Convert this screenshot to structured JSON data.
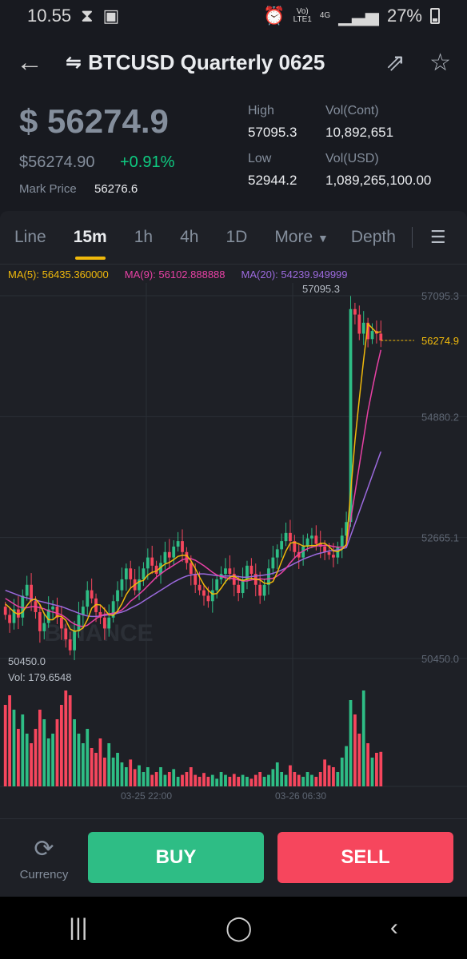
{
  "status_bar": {
    "time": "10.55",
    "network_top": "Vo)",
    "network_bottom": "LTE1",
    "data_type": "4G",
    "battery": "27%"
  },
  "header": {
    "title": "BTCUSD Quarterly 0625",
    "swap_icon": "swap-arrows-icon",
    "share_icon": "share-icon",
    "favorite_icon": "star-icon"
  },
  "price": {
    "main": "$ 56274.9",
    "secondary": "$56274.90",
    "change": "+0.91%",
    "mark_label": "Mark Price",
    "mark_value": "56276.6",
    "high_label": "High",
    "high_value": "57095.3",
    "low_label": "Low",
    "low_value": "52944.2",
    "vol_cont_label": "Vol(Cont)",
    "vol_cont_value": "10,892,651",
    "vol_usd_label": "Vol(USD)",
    "vol_usd_value": "1,089,265,100.00"
  },
  "tabs": [
    {
      "label": "Line"
    },
    {
      "label": "15m"
    },
    {
      "label": "1h"
    },
    {
      "label": "4h"
    },
    {
      "label": "1D"
    },
    {
      "label": "More"
    },
    {
      "label": "Depth"
    }
  ],
  "ma": {
    "ma5": "MA(5): 56435.360000",
    "ma9": "MA(9): 56102.888888",
    "ma20": "MA(20): 54239.949999"
  },
  "colors": {
    "up": "#2ebd85",
    "down": "#f6465d",
    "ma5": "#f0b90b",
    "ma9": "#e841a5",
    "ma20": "#9c6ade"
  },
  "chart_data": {
    "type": "candlestick",
    "y_ticks": [
      57095.3,
      54880.2,
      52665.1,
      50450.0
    ],
    "y_tick_labels": [
      "57095.3",
      "54880.2",
      "52665.1",
      "50450.0"
    ],
    "ylim": [
      50450.0,
      57095.3
    ],
    "x_tick_labels": [
      "03-25 22:00",
      "03-26 06:30"
    ],
    "high_label": "57095.3",
    "low_label": "50450.0",
    "last_price_label": "56274.9",
    "volume_label": "Vol: 179.6548",
    "watermark": "BINANCE",
    "close_series": [
      51250,
      51100,
      51350,
      51200,
      51600,
      51800,
      51500,
      51300,
      50950,
      51100,
      51350,
      51400,
      51200,
      51000,
      50800,
      50600,
      50950,
      51250,
      51400,
      51700,
      51550,
      51300,
      51200,
      51000,
      51200,
      51500,
      51700,
      51900,
      52100,
      51900,
      51700,
      51900,
      52100,
      52300,
      52150,
      52000,
      52200,
      52400,
      52300,
      52500,
      52600,
      52400,
      52200,
      52000,
      51800,
      51700,
      51600,
      51500,
      51700,
      51900,
      52000,
      52100,
      52000,
      51800,
      51650,
      51900,
      52150,
      52000,
      51800,
      51600,
      51800,
      52100,
      52300,
      52450,
      52600,
      52750,
      52600,
      52400,
      52300,
      52500,
      52650,
      52700,
      52550,
      52500,
      52400,
      52350,
      52300,
      52500,
      52700,
      52950,
      56850,
      56750,
      56400,
      56600,
      56300,
      56450,
      56400,
      56274.9
    ],
    "ma5_series": [
      51450,
      51380,
      51300,
      51260,
      51300,
      51420,
      51520,
      51540,
      51440,
      51270,
      51160,
      51160,
      51230,
      51220,
      51150,
      50990,
      50950,
      50960,
      51010,
      51160,
      51370,
      51440,
      51430,
      51350,
      51250,
      51240,
      51320,
      51450,
      51620,
      51740,
      51800,
      51860,
      51880,
      51980,
      52030,
      52050,
      52120,
      52180,
      52210,
      52260,
      52320,
      52340,
      52340,
      52240,
      52100,
      51940,
      51800,
      51700,
      51630,
      51640,
      51740,
      51860,
      51940,
      51960,
      51910,
      51880,
      51900,
      51920,
      51900,
      51890,
      51830,
      51820,
      51860,
      52030,
      52230,
      52420,
      52560,
      52580,
      52550,
      52510,
      52510,
      52520,
      52520,
      52560,
      52560,
      52500,
      52420,
      52410,
      52450,
      52540,
      53490,
      54440,
      55200,
      55920,
      56580,
      56500,
      56420,
      56435.36
    ],
    "ma9_series": [
      51550,
      51500,
      51450,
      51400,
      51380,
      51380,
      51400,
      51400,
      51380,
      51360,
      51320,
      51300,
      51280,
      51250,
      51200,
      51130,
      51080,
      51050,
      51030,
      51060,
      51120,
      51180,
      51230,
      51260,
      51270,
      51280,
      51300,
      51340,
      51410,
      51500,
      51560,
      51630,
      51700,
      51780,
      51860,
      51940,
      52000,
      52060,
      52110,
      52160,
      52210,
      52260,
      52280,
      52280,
      52250,
      52200,
      52150,
      52090,
      52030,
      51980,
      51950,
      51930,
      51920,
      51910,
      51890,
      51870,
      51870,
      51890,
      51900,
      51910,
      51900,
      51910,
      51920,
      51960,
      52020,
      52100,
      52200,
      52290,
      52370,
      52420,
      52460,
      52490,
      52510,
      52520,
      52520,
      52520,
      52500,
      52490,
      52490,
      52510,
      52990,
      53480,
      53980,
      54480,
      54980,
      55380,
      55760,
      56102.89
    ],
    "ma20_series": [
      51700,
      51670,
      51640,
      51610,
      51580,
      51560,
      51540,
      51520,
      51500,
      51480,
      51460,
      51440,
      51420,
      51400,
      51370,
      51340,
      51310,
      51280,
      51250,
      51230,
      51220,
      51220,
      51230,
      51240,
      51250,
      51260,
      51280,
      51300,
      51330,
      51370,
      51410,
      51450,
      51500,
      51550,
      51600,
      51650,
      51700,
      51750,
      51800,
      51850,
      51890,
      51930,
      51960,
      51980,
      51990,
      52000,
      52000,
      51990,
      51980,
      51970,
      51960,
      51960,
      51960,
      51960,
      51950,
      51940,
      51940,
      51950,
      51960,
      51970,
      51980,
      51990,
      52010,
      52040,
      52070,
      52110,
      52150,
      52190,
      52230,
      52270,
      52300,
      52330,
      52360,
      52380,
      52400,
      52420,
      52430,
      52440,
      52460,
      52480,
      52700,
      52920,
      53140,
      53360,
      53580,
      53800,
      54020,
      54239.95
    ],
    "volume_series": [
      0.85,
      0.95,
      0.8,
      0.6,
      0.75,
      0.55,
      0.45,
      0.6,
      0.8,
      0.7,
      0.5,
      0.55,
      0.7,
      0.85,
      1.0,
      0.95,
      0.7,
      0.55,
      0.45,
      0.6,
      0.4,
      0.35,
      0.5,
      0.3,
      0.45,
      0.3,
      0.35,
      0.25,
      0.2,
      0.28,
      0.18,
      0.22,
      0.15,
      0.2,
      0.12,
      0.15,
      0.2,
      0.12,
      0.15,
      0.18,
      0.1,
      0.12,
      0.15,
      0.2,
      0.12,
      0.1,
      0.14,
      0.1,
      0.12,
      0.08,
      0.15,
      0.12,
      0.1,
      0.13,
      0.1,
      0.12,
      0.1,
      0.08,
      0.12,
      0.15,
      0.1,
      0.12,
      0.18,
      0.25,
      0.15,
      0.12,
      0.22,
      0.15,
      0.12,
      0.1,
      0.15,
      0.12,
      0.1,
      0.15,
      0.28,
      0.22,
      0.2,
      0.15,
      0.3,
      0.42,
      0.9,
      0.75,
      0.55,
      1.0,
      0.45,
      0.3,
      0.35,
      0.36
    ]
  },
  "bottom": {
    "currency_label": "Currency",
    "buy_label": "BUY",
    "sell_label": "SELL"
  }
}
